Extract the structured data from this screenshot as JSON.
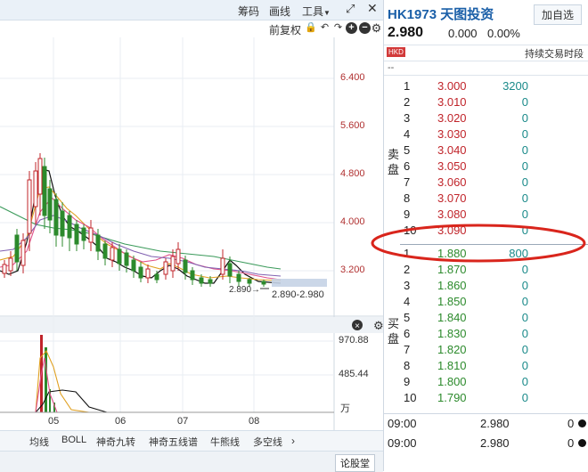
{
  "toolbar": {
    "chips_label": "筹码",
    "draw_label": "画线",
    "tools_label": "工具",
    "adjust_label": "前复权"
  },
  "stock": {
    "code_name": "HK1973 天图投资",
    "add_label": "加自选",
    "price": "2.980",
    "change": "0.000",
    "change_pct": "0.00%",
    "market_badge": "HKD",
    "session": "持续交易时段",
    "dash": "--"
  },
  "orderbook": {
    "sell_label": "卖盘",
    "buy_label": "买盘",
    "sell": [
      {
        "level": "10",
        "price": "3.090",
        "volume": "0"
      },
      {
        "level": "9",
        "price": "3.080",
        "volume": "0"
      },
      {
        "level": "8",
        "price": "3.070",
        "volume": "0"
      },
      {
        "level": "7",
        "price": "3.060",
        "volume": "0"
      },
      {
        "level": "6",
        "price": "3.050",
        "volume": "0"
      },
      {
        "level": "5",
        "price": "3.040",
        "volume": "0"
      },
      {
        "level": "4",
        "price": "3.030",
        "volume": "0"
      },
      {
        "level": "3",
        "price": "3.020",
        "volume": "0"
      },
      {
        "level": "2",
        "price": "3.010",
        "volume": "0"
      },
      {
        "level": "1",
        "price": "3.000",
        "volume": "3200"
      }
    ],
    "buy": [
      {
        "level": "1",
        "price": "1.880",
        "volume": "800"
      },
      {
        "level": "2",
        "price": "1.870",
        "volume": "0"
      },
      {
        "level": "3",
        "price": "1.860",
        "volume": "0"
      },
      {
        "level": "4",
        "price": "1.850",
        "volume": "0"
      },
      {
        "level": "5",
        "price": "1.840",
        "volume": "0"
      },
      {
        "level": "6",
        "price": "1.830",
        "volume": "0"
      },
      {
        "level": "7",
        "price": "1.820",
        "volume": "0"
      },
      {
        "level": "8",
        "price": "1.810",
        "volume": "0"
      },
      {
        "level": "9",
        "price": "1.800",
        "volume": "0"
      },
      {
        "level": "10",
        "price": "1.790",
        "volume": "0"
      }
    ]
  },
  "trades": [
    {
      "time": "09:00",
      "price": "2.980",
      "volume": "0"
    },
    {
      "time": "09:00",
      "price": "2.980",
      "volume": "0"
    }
  ],
  "chart_data": {
    "type": "candlestick",
    "price_ticks": [
      "6.400",
      "5.600",
      "4.800",
      "4.000",
      "3.200"
    ],
    "volume_ticks": [
      "970.88",
      "485.44"
    ],
    "volume_unit": "万",
    "x_labels": [
      "05",
      "06",
      "07",
      "08"
    ],
    "low_marker": "2.890",
    "range_label": "2.890-2.980"
  },
  "indicator_tabs": [
    "均线",
    "BOLL",
    "神奇九转",
    "神奇五线谱",
    "牛熊线",
    "多空线"
  ],
  "footer": {
    "forum_label": "论股堂"
  }
}
